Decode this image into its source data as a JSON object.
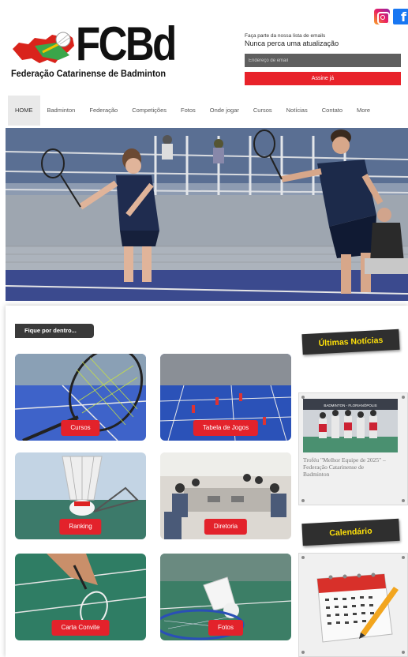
{
  "logo": {
    "main_text": "FCBd",
    "subtitle": "Federação Catarinense de Badminton"
  },
  "social": {
    "instagram_icon": "instagram-icon",
    "facebook_glyph": "f"
  },
  "newsletter": {
    "small_text": "Faça parte da nossa lista de emails",
    "headline": "Nunca perca uma atualização",
    "email_placeholder": "Endereço de email",
    "submit_label": "Assine já"
  },
  "nav": {
    "items": [
      "HOME",
      "Badminton",
      "Federação",
      "Competições",
      "Fotos",
      "Onde jogar",
      "Cursos",
      "Notícias",
      "Contato",
      "More"
    ],
    "active": "HOME"
  },
  "section": {
    "fique_label": "Fique por dentro..."
  },
  "tiles": {
    "cursos": "Cursos",
    "tabela": "Tabela de Jogos",
    "ranking": "Ranking",
    "diretoria": "Diretoria",
    "carta": "Carta Convite",
    "fotos": "Fotos"
  },
  "sidebar": {
    "news_title": "Últimas Notícias",
    "news_caption": "Troféu \"Melhor Equipe de 2025\" – Federação Catarinense de Badminton",
    "news_banner": "BADMINTON - FLORIANÓPOLIS",
    "calendar_title": "Calendário"
  },
  "colors": {
    "accent_red": "#e3222b",
    "dark": "#2f2f2f",
    "yellow": "#ffe10a"
  }
}
